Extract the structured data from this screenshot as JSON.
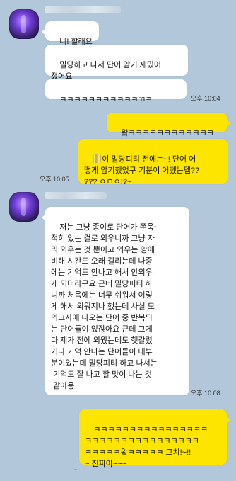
{
  "conversation": {
    "messages": [
      {
        "id": "m1",
        "side": "incoming",
        "text": "네! 할래요"
      },
      {
        "id": "m2",
        "side": "incoming",
        "text": "밀당하고 나서 단어 암기 재밌어\n졌어요"
      },
      {
        "id": "m3",
        "side": "incoming",
        "text": "ㅋㅋㅋㅋㅋㅋㅋㅋㅋㅋㅋㄲㅋ",
        "time": "오후 10:04"
      },
      {
        "id": "m4",
        "side": "outgoing",
        "text": "왘ㅋㅋㅋㅋㅋㅋㅋㅋㅋㅋㅋㅋ"
      },
      {
        "id": "m5",
        "side": "outgoing",
        "text_after_redaction": "이 밀당피티 전에는~! 단어 어\n떻게 암기했었구 기분이 어뗐는뎁??\n??? ㅇㅁㅇ!?~",
        "time": "오후 10:05"
      },
      {
        "id": "m6",
        "side": "incoming",
        "text": "저는 그냥 종이로 단어가 쭈욱~\n적혀 있는 걸로 외우니까 그냥 자\n리 외우는 것 뿐이고 외우는 양에\n비해 시간도 오래 걸리는데 나중\n에는 기억도 안나고 해서 안외우\n게 되더라구요 근데 밀당피티 하\n니까 처음에는 너무 쉬워서 이렇\n게 해서 외워지나 했는데 사실 모\n의고사에 나오는 단어 중 반복되\n는 단어들이 있잖아요 근데 그게\n다 제가 전에 외웠는데도 헷갈렸\n거나 기억 안나는 단어들이 대부\n분이었는데 밀당피티 하고 나서는\n 기억도 잘 나고 할 맛이 나는 것\n 같아용",
        "time": "오후 10:08"
      },
      {
        "id": "m7",
        "side": "outgoing",
        "text": "ㅋㅋㅋㅋㅋㅋㅋㅋㅋㅋㅋㅋㅋㅋㅋㅋ\nㅋㅋㅋㅋㅋㅋㅋㅋㅋㅋㅋㅋㅋㅋㅋㅋ\nㅋㅋㅋㅋㅋ왘ㅋㅋㅋㅋㅋ 그치!~!!\n~ 진짜아~~~"
      }
    ]
  }
}
